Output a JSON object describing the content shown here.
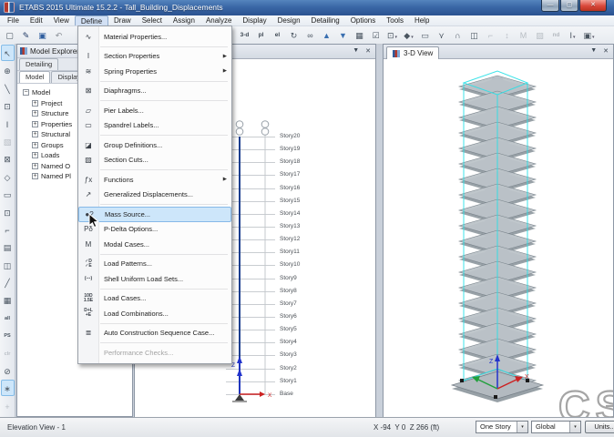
{
  "window": {
    "title": "ETABS 2015 Ultimate 15.2.2 - Tall_Building_Displacements",
    "controls": [
      {
        "name": "minimize-button",
        "glyph": "—"
      },
      {
        "name": "maximize-button",
        "glyph": "▢"
      },
      {
        "name": "close-button",
        "glyph": "✕",
        "cls": "close"
      }
    ]
  },
  "menu_bar": {
    "items": [
      {
        "label": "File",
        "name": "menubar-file"
      },
      {
        "label": "Edit",
        "name": "menubar-edit"
      },
      {
        "label": "View",
        "name": "menubar-view"
      },
      {
        "label": "Define",
        "state": "active",
        "name": "menubar-define"
      },
      {
        "label": "Draw",
        "name": "menubar-draw"
      },
      {
        "label": "Select",
        "name": "menubar-select"
      },
      {
        "label": "Assign",
        "name": "menubar-assign"
      },
      {
        "label": "Analyze",
        "name": "menubar-analyze"
      },
      {
        "label": "Display",
        "name": "menubar-display"
      },
      {
        "label": "Design",
        "name": "menubar-design"
      },
      {
        "label": "Detailing",
        "name": "menubar-detailing"
      },
      {
        "label": "Options",
        "name": "menubar-options"
      },
      {
        "label": "Tools",
        "name": "menubar-tools"
      },
      {
        "label": "Help",
        "name": "menubar-help"
      }
    ]
  },
  "define_menu": {
    "items": [
      {
        "icon": "∿",
        "label": "Material Properties...",
        "name": "menu-item-material-properties",
        "sep_after": true
      },
      {
        "icon": "I",
        "label": "Section Properties",
        "arrow": "▶",
        "name": "menu-item-section-properties"
      },
      {
        "icon": "≋",
        "label": "Spring Properties",
        "arrow": "▶",
        "name": "menu-item-spring-properties",
        "sep_after": true
      },
      {
        "icon": "⊠",
        "label": "Diaphragms...",
        "name": "menu-item-diaphragms",
        "sep_after": true
      },
      {
        "icon": "▱",
        "label": "Pier Labels...",
        "name": "menu-item-pier-labels"
      },
      {
        "icon": "▭",
        "label": "Spandrel Labels...",
        "name": "menu-item-spandrel-labels",
        "sep_after": true
      },
      {
        "icon": "◪",
        "label": "Group Definitions...",
        "name": "menu-item-group-definitions"
      },
      {
        "icon": "▨",
        "label": "Section Cuts...",
        "name": "menu-item-section-cuts",
        "sep_after": true
      },
      {
        "icon": "ƒx",
        "label": "Functions",
        "arrow": "▶",
        "name": "menu-item-functions"
      },
      {
        "icon": "↗",
        "label": "Generalized Displacements...",
        "name": "menu-item-generalized-displacements",
        "sep_after": true
      },
      {
        "icon": "●?",
        "label": "Mass Source...",
        "state": "highlighted",
        "name": "menu-item-mass-source"
      },
      {
        "icon": "Pδ",
        "label": "P-Delta Options...",
        "name": "menu-item-p-delta-options"
      },
      {
        "icon": "M",
        "label": "Modal Cases...",
        "name": "menu-item-modal-cases",
        "sep_after": true
      },
      {
        "icon": "✓D\n✓E",
        "cls": "small-ico",
        "label": "Load Patterns...",
        "name": "menu-item-load-patterns"
      },
      {
        "icon": "(⋯)",
        "cls": "small-ico",
        "label": "Shell Uniform Load Sets...",
        "name": "menu-item-shell-uniform-load-sets",
        "sep_after": true
      },
      {
        "icon": "10D\n1.5E",
        "cls": "small-ico",
        "label": "Load Cases...",
        "name": "menu-item-load-cases"
      },
      {
        "icon": "D+L\n+E",
        "cls": "small-ico",
        "label": "Load Combinations...",
        "name": "menu-item-load-combinations",
        "sep_after": true
      },
      {
        "icon": "≣",
        "label": "Auto Construction Sequence Case...",
        "name": "menu-item-auto-construction-sequence-case",
        "sep_after": true
      },
      {
        "icon": "",
        "label": "Performance Checks...",
        "state": "disabled",
        "name": "menu-item-performance-checks"
      }
    ]
  },
  "toolbar_top": {
    "left_buttons": [
      {
        "name": "new-model-button",
        "glyph": "▢"
      },
      {
        "name": "open-model-button",
        "glyph": "✎",
        "color": "#1f3864"
      },
      {
        "name": "save-model-button",
        "glyph": "▣",
        "color": "#2e5d9e"
      },
      {
        "name": "undo-button",
        "glyph": "↶",
        "color": "#8a8f96"
      }
    ],
    "right_buttons": [
      {
        "name": "view-3d-button",
        "glyph": "3-d",
        "cls": "txt"
      },
      {
        "name": "plan-view-button",
        "glyph": "pl",
        "cls": "txt"
      },
      {
        "name": "elevation-view-button",
        "glyph": "el",
        "cls": "txt"
      },
      {
        "name": "rotate-3d-view-button",
        "glyph": "↻"
      },
      {
        "name": "perspective-toggle-button",
        "glyph": "∞"
      },
      {
        "name": "move-story-up-button",
        "glyph": "▲",
        "color": "#3a6fb0"
      },
      {
        "name": "move-story-down-button",
        "glyph": "▼",
        "color": "#3a6fb0"
      },
      {
        "name": "window-layout-button",
        "glyph": "▦"
      },
      {
        "name": "display-options-button",
        "glyph": "☑"
      },
      {
        "name": "object-view-options-button",
        "glyph": "⊡",
        "dd": true
      },
      {
        "name": "shrink-objects-button",
        "glyph": "◆",
        "dd": true
      },
      {
        "name": "rubber-band-zoom-button",
        "glyph": "▭"
      },
      {
        "name": "snap-options-button",
        "glyph": "⋎"
      },
      {
        "name": "building-elevation-button",
        "glyph": "∩"
      },
      {
        "name": "wall-elevation-button",
        "glyph": "◫"
      },
      {
        "name": "inactive-tool-button",
        "glyph": "⌐",
        "state": "disabled"
      },
      {
        "name": "inactive-tool-button",
        "glyph": "↕",
        "state": "disabled"
      },
      {
        "name": "inactive-tool-button",
        "glyph": "M",
        "state": "disabled"
      },
      {
        "name": "inactive-tool-button",
        "glyph": "▨",
        "state": "disabled"
      },
      {
        "name": "nd-tool-button",
        "glyph": "nd",
        "cls": "txt",
        "state": "disabled"
      },
      {
        "name": "text-style-button",
        "glyph": "I",
        "dd": true
      },
      {
        "name": "area-display-button",
        "glyph": "▣",
        "dd": true
      }
    ]
  },
  "toolbar_left": {
    "buttons": [
      {
        "name": "select-pointer-button",
        "glyph": "↖",
        "state": "active"
      },
      {
        "name": "reshape-objects-button",
        "glyph": "⊕"
      },
      {
        "name": "draw-joint-button",
        "glyph": "╲"
      },
      {
        "name": "draw-frame-button",
        "glyph": "⊡"
      },
      {
        "name": "quick-draw-frame-button",
        "glyph": "I"
      },
      {
        "name": "quick-draw-braces-button",
        "glyph": "▧",
        "state": "disabled"
      },
      {
        "name": "quick-draw-secondary-beams-button",
        "glyph": "⊠"
      },
      {
        "name": "draw-floor-button",
        "glyph": "◇"
      },
      {
        "name": "draw-rectangular-floor-button",
        "glyph": "▭"
      },
      {
        "name": "quick-draw-floor-button",
        "glyph": "⊡"
      },
      {
        "name": "draw-wall-button",
        "glyph": "⌐"
      },
      {
        "name": "quick-draw-wall-button",
        "glyph": "▤"
      },
      {
        "name": "quick-draw-area-button",
        "glyph": "◫"
      },
      {
        "name": "draw-link-button",
        "glyph": "╱"
      },
      {
        "name": "edit-grid-button",
        "glyph": "▦"
      },
      {
        "name": "select-all-button",
        "glyph": "all",
        "cls": "txt"
      },
      {
        "name": "select-previous-button",
        "glyph": "PS",
        "cls": "txt"
      },
      {
        "name": "clear-selection-button",
        "glyph": "clr",
        "cls": "txt",
        "state": "disabled"
      },
      {
        "name": "deselect-button",
        "glyph": "⊘"
      },
      {
        "name": "show-joints-button",
        "glyph": "∗",
        "state": "active"
      },
      {
        "name": "snap-toggle-button",
        "glyph": "+",
        "state": "disabled"
      }
    ]
  },
  "model_explorer": {
    "title": "Model Explorer",
    "tab_row1": [
      {
        "label": "Detailing",
        "name": "tab-detailing"
      }
    ],
    "tab_row2": [
      {
        "label": "Model",
        "state": "active",
        "name": "tab-model"
      },
      {
        "label": "Display",
        "name": "tab-display"
      }
    ],
    "tree": {
      "root": "Model",
      "root_expander": "−",
      "child_expander": "+",
      "children": [
        "Project",
        "Structure",
        "Properties",
        "Structural",
        "Groups",
        "Loads",
        "Named O",
        "Named Pl"
      ]
    }
  },
  "elevation_view": {
    "stories": [
      "Story20",
      "Story19",
      "Story18",
      "Story17",
      "Story16",
      "Story15",
      "Story14",
      "Story13",
      "Story12",
      "Story11",
      "Story10",
      "Story9",
      "Story8",
      "Story7",
      "Story6",
      "Story5",
      "Story4",
      "Story3",
      "Story2",
      "Story1",
      "Base"
    ],
    "axis_labels": {
      "z": "Z",
      "x": "X"
    },
    "collapse_glyph": "▼",
    "close_glyph": "✕"
  },
  "three_d_view": {
    "tab_label": "3-D View",
    "axis_labels": {
      "z": "Z",
      "x": "X"
    },
    "collapse_glyph": "▼",
    "close_glyph": "✕"
  },
  "status_bar": {
    "view_label": "Elevation View - 1",
    "coordinates": "X -94  Y 0  Z 266 (ft)",
    "story_selector": "One Story",
    "coord_system": "Global",
    "units_button": "Units...",
    "combo_caret": "▾"
  },
  "colors": {
    "titlebar_blue": "#3a67a6",
    "menu_highlight": "#cde6fa",
    "menu_highlight_border": "#86b9e8",
    "column_blue": "#1d3f8f",
    "axis_red": "#cc2222",
    "axis_blue": "#2233cc",
    "axis_green": "#21a03c",
    "selection_cyan": "#29e0e6",
    "slab_gray": "#bcc3c8"
  }
}
